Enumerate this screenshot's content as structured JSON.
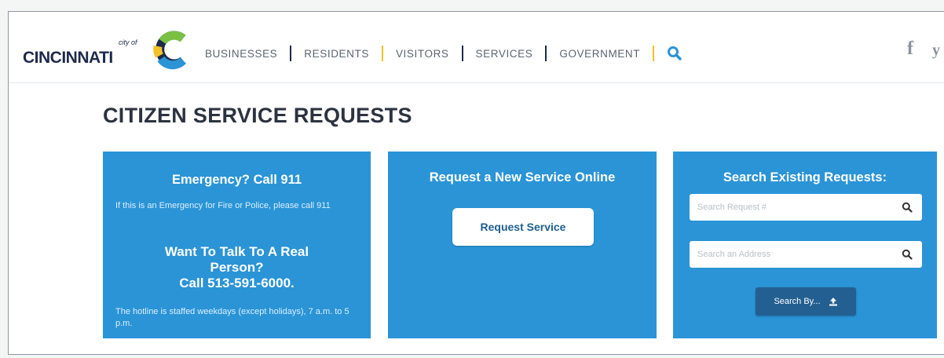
{
  "brand": {
    "city_of": "city of",
    "name": "CINCINNATI",
    "colors": {
      "navy": "#1e2a4a",
      "blue": "#2a94d6",
      "green": "#7ac043",
      "yellow": "#f2c22b"
    }
  },
  "nav": {
    "items": [
      {
        "label": "BUSINESSES",
        "sep_color": "#1e2a4a"
      },
      {
        "label": "RESIDENTS",
        "sep_color": "#f2c22b"
      },
      {
        "label": "VISITORS",
        "sep_color": "#1e2a4a"
      },
      {
        "label": "SERVICES",
        "sep_color": "#1e2a4a"
      },
      {
        "label": "GOVERNMENT",
        "sep_color": "#f2c22b"
      }
    ],
    "search_icon": "search-icon",
    "search_color": "#2a94d6"
  },
  "social": {
    "facebook": "f",
    "twitter": "y"
  },
  "page": {
    "title": "CITIZEN SERVICE REQUESTS"
  },
  "emergency": {
    "title": "Emergency? Call 911",
    "note": "If this is an Emergency for Fire or Police, please call 911",
    "talk_line1": "Want To Talk To A Real",
    "talk_line2": "Person?",
    "call_line": "Call 513-591-6000.",
    "hotline_note": "The hotline is staffed weekdays (except holidays), 7 a.m. to 5 p.m."
  },
  "request": {
    "title": "Request a New Service Online",
    "button_label": "Request Service"
  },
  "search": {
    "title": "Search Existing Requests:",
    "request_placeholder": "Search Request #",
    "address_placeholder": "Search an Address",
    "search_by_label": "Search By...",
    "search_icon": "search-icon",
    "upload_icon": "upload-icon"
  },
  "colors": {
    "panel": "#2a94d6",
    "search_by_button": "#245f91",
    "title_text": "#2c3340"
  }
}
